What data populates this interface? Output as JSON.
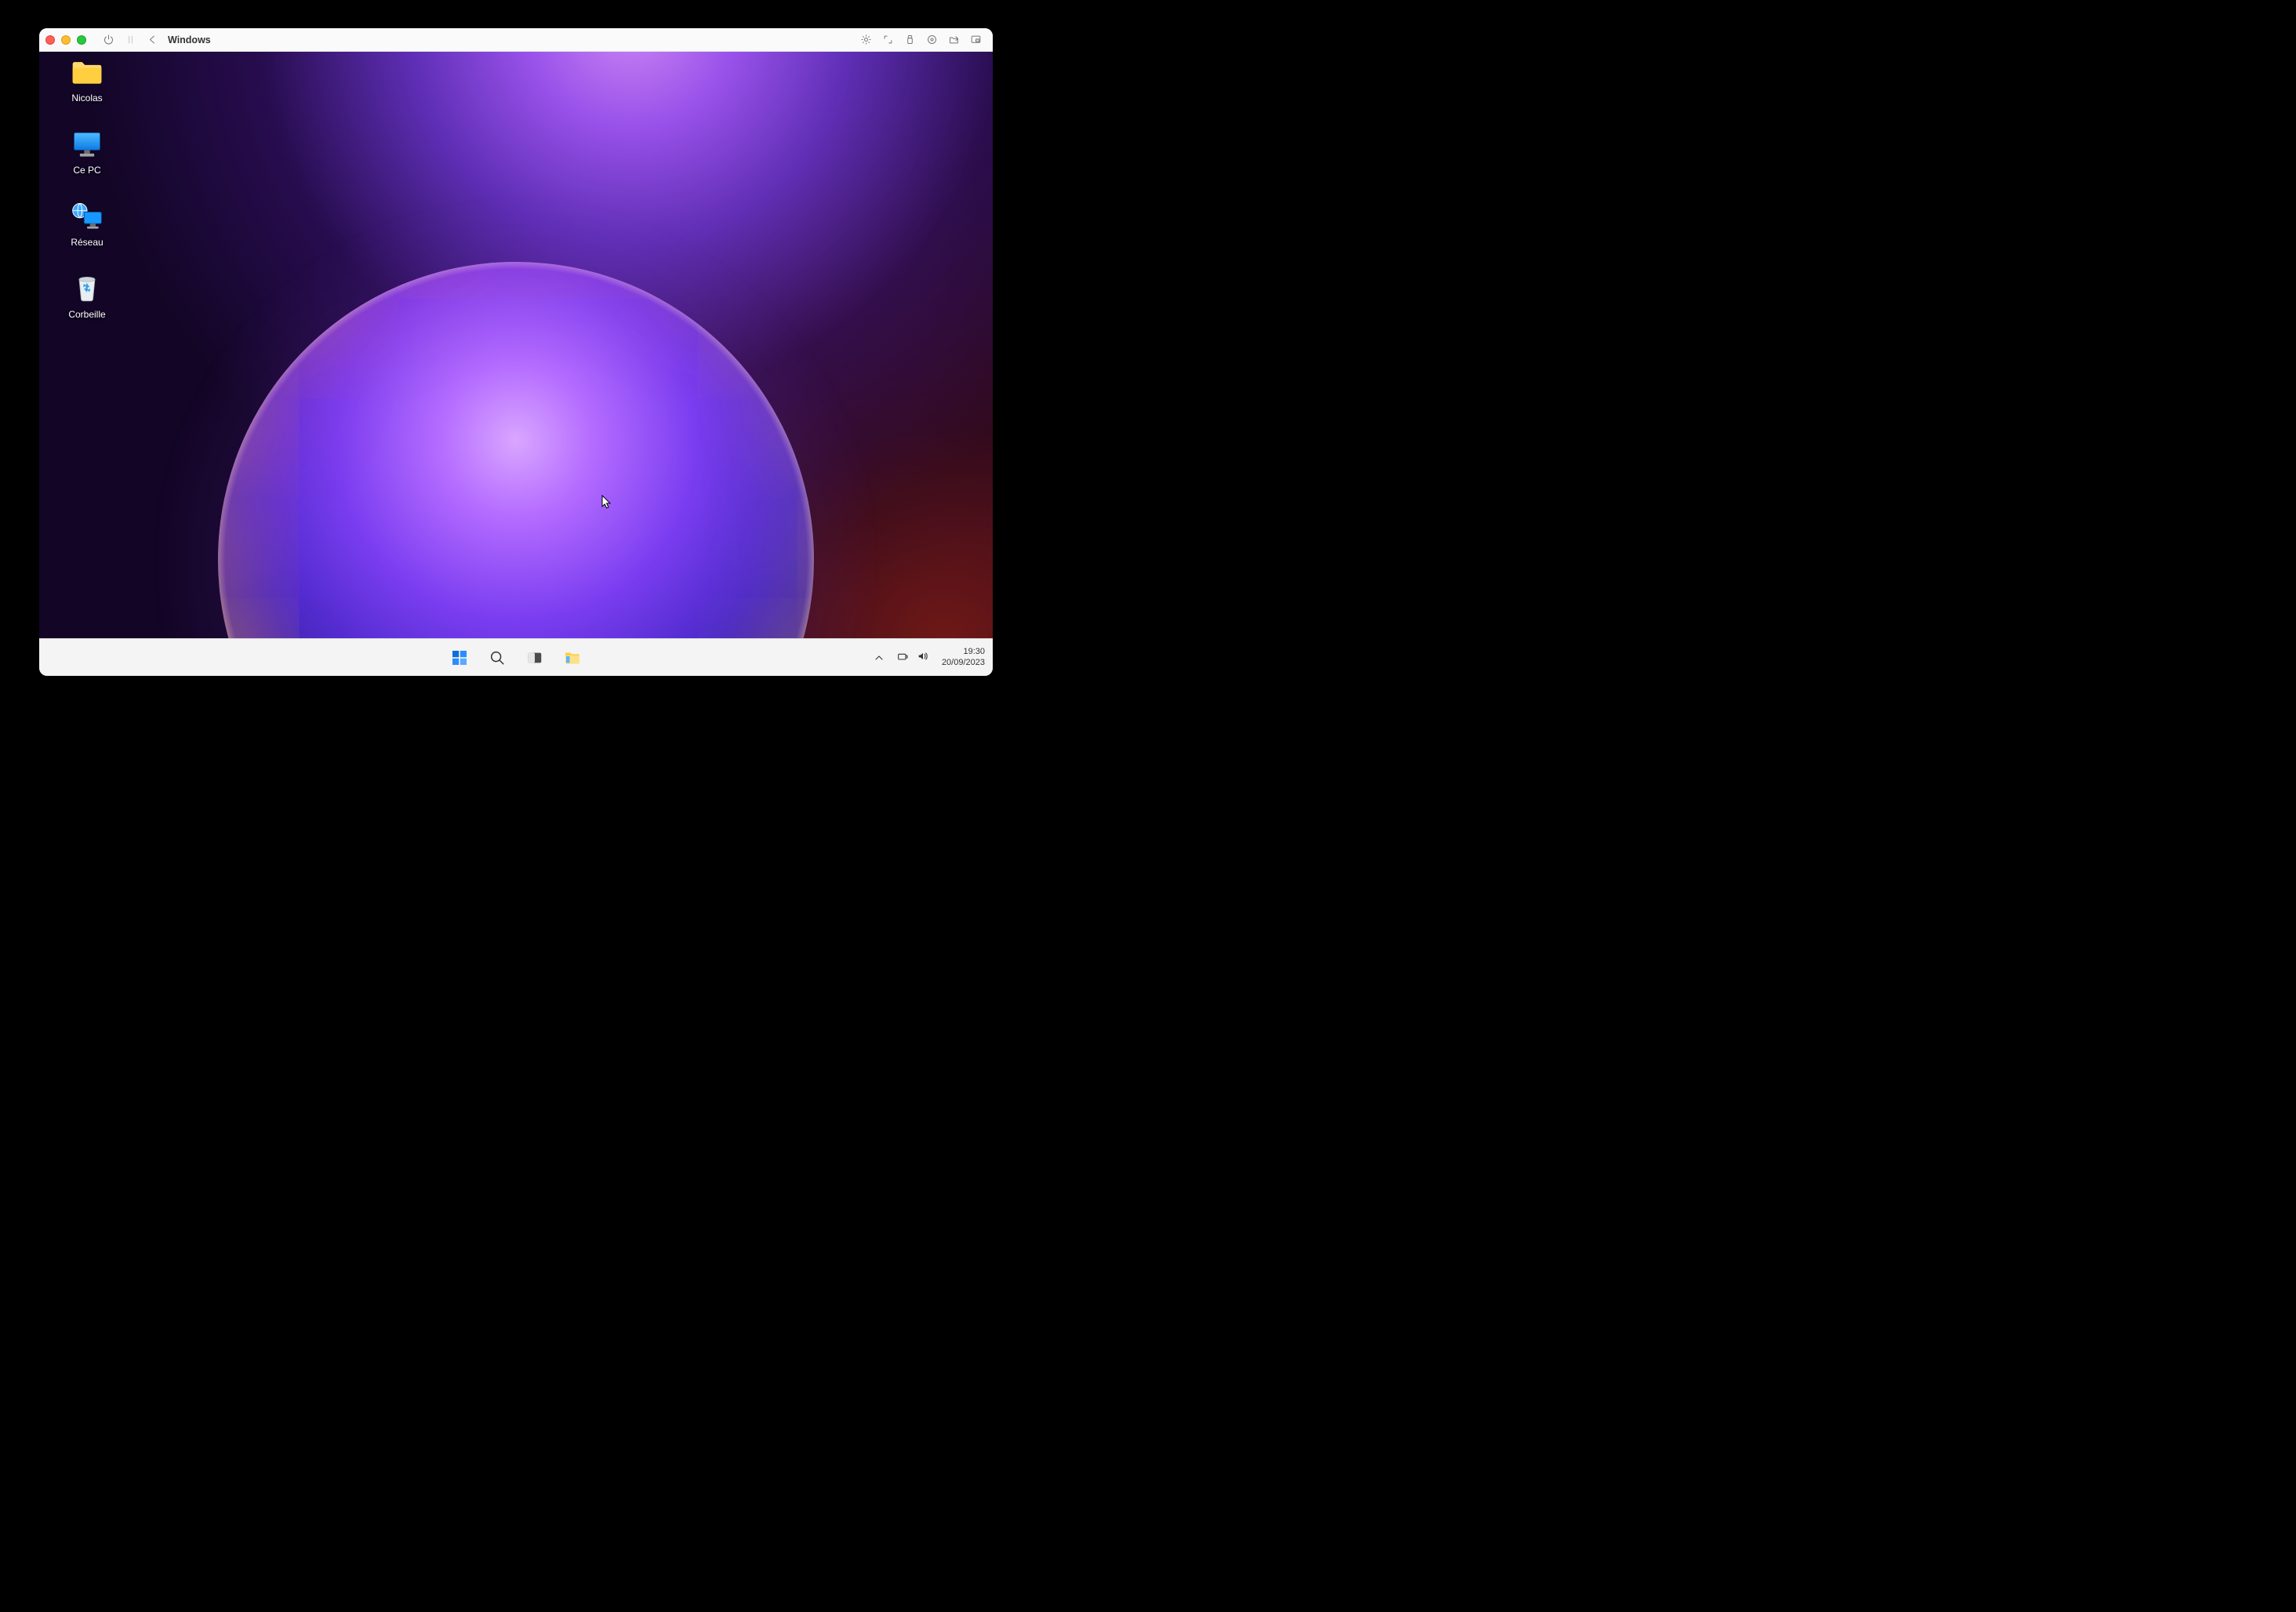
{
  "host": {
    "title": "Windows"
  },
  "desktop": {
    "icons": [
      {
        "id": "user-folder",
        "label": "Nicolas"
      },
      {
        "id": "this-pc",
        "label": "Ce PC"
      },
      {
        "id": "network",
        "label": "Réseau"
      },
      {
        "id": "recycle-bin",
        "label": "Corbeille"
      }
    ]
  },
  "taskbar": {
    "buttons": [
      {
        "id": "start",
        "name": "start-button"
      },
      {
        "id": "search",
        "name": "search-button"
      },
      {
        "id": "task-view",
        "name": "task-view-button"
      },
      {
        "id": "file-explorer",
        "name": "file-explorer-button"
      }
    ]
  },
  "tray": {
    "chevron": "show-hidden-icons",
    "network": "network-status",
    "volume": "volume-status",
    "time": "19:30",
    "date": "20/09/2023"
  }
}
